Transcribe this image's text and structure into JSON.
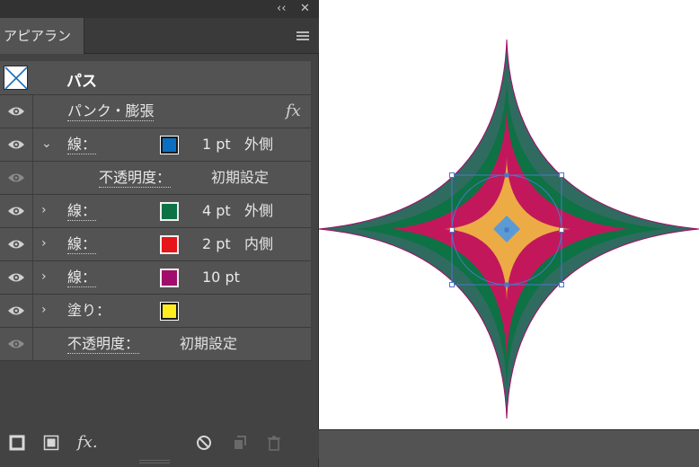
{
  "window": {
    "collapse_glyph": "‹‹",
    "close_glyph": "✕"
  },
  "panel": {
    "tab_label": "アピアランス",
    "menu_icon": "hamburger-menu-icon",
    "object_title": "パス",
    "effect": {
      "label": "パンク・膨張",
      "fx_label": "fx"
    },
    "rows": [
      {
        "label": "線：",
        "color": "#0a6fc2",
        "value": "1 pt",
        "position": "外側",
        "expanded": true
      },
      {
        "label": "不透明度：",
        "value": "初期設定",
        "sub": true
      },
      {
        "label": "線：",
        "color": "#0d7244",
        "value": "4 pt",
        "position": "外側"
      },
      {
        "label": "線：",
        "color": "#e8141b",
        "value": "2 pt",
        "position": "内側"
      },
      {
        "label": "線：",
        "color": "#a10d6b",
        "value": "10 pt",
        "position": ""
      },
      {
        "label": "塗り：",
        "color": "#ffed1f",
        "value": "",
        "position": ""
      },
      {
        "label": "不透明度：",
        "value": "初期設定"
      }
    ],
    "bottom_icons": [
      "add-stroke-icon",
      "add-fill-icon",
      "add-effect-icon",
      "clear-appearance-icon",
      "duplicate-item-icon",
      "delete-item-icon"
    ],
    "fx_bottom": "fx."
  },
  "canvas": {
    "shape_colors": {
      "outer": "#2f6b5f",
      "mid": "#0d7244",
      "inner": "#c2185b",
      "core": "#f4c542",
      "selection": "#4a78c8"
    }
  }
}
